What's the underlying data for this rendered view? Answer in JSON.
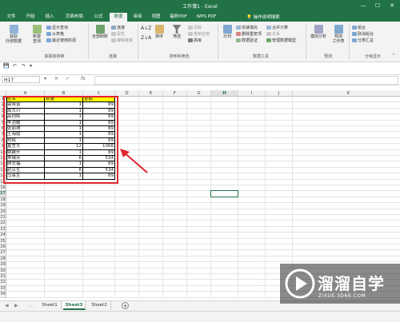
{
  "window": {
    "title": "工作簿1 - Excel",
    "controls": [
      "—",
      "☐",
      "✕"
    ]
  },
  "ribbon_tabs": [
    "文件",
    "开始",
    "插入",
    "页面布局",
    "公式",
    "数据",
    "审阅",
    "视图",
    "福昕PDF",
    "WPS PDF"
  ],
  "active_tab": "数据",
  "tell_me": "操作说明搜索",
  "ribbon": {
    "get_external_label": "获取\n外部数据",
    "new_query_label": "新建\n查询",
    "show_queries": "显示查询",
    "from_table": "从表格",
    "recent_sources": "最近使用的源",
    "group_get_transform": "获取和转换",
    "refresh_all_label": "全部刷新",
    "connections": "连接",
    "properties": "属性",
    "edit_links": "编辑链接",
    "group_connections": "连接",
    "sort_label": "排序",
    "filter_label": "筛选",
    "clear": "清除",
    "reapply": "重新应用",
    "advanced": "高级",
    "group_sort_filter": "排序和筛选",
    "text_to_columns_label": "分列",
    "flash_fill": "快速填充",
    "remove_duplicates": "删除重复项",
    "data_validation": "数据验证",
    "consolidate": "合并计算",
    "relationships": "关系",
    "manage_data_model": "管理数据模型",
    "group_data_tools": "数据工具",
    "what_if_label": "模拟分析",
    "forecast_sheet_label": "预测\n工作表",
    "group_forecast": "预测",
    "group_btn": "组合",
    "ungroup_btn": "取消组合",
    "subtotal": "分类汇总",
    "group_outline": "分级显示"
  },
  "name_box": "H17",
  "formula": "",
  "columns": [
    "A",
    "B",
    "C",
    "D",
    "E",
    "F",
    "G",
    "H",
    "I",
    "J",
    "K"
  ],
  "selected_column": "H",
  "selected_row": "17",
  "rows": [
    "1",
    "2",
    "3",
    "4",
    "5",
    "6",
    "7",
    "8",
    "9",
    "10",
    "11",
    "12",
    "13",
    "14",
    "15",
    "16",
    "17",
    "18",
    "19",
    "20",
    "21",
    "22",
    "23",
    "24",
    "25",
    "26",
    "27",
    "28",
    "29",
    "30",
    "31",
    "32",
    "33",
    "34"
  ],
  "table": {
    "headers": [
      "姓名",
      "数量",
      "金额"
    ],
    "rows": [
      [
        "龚晓普",
        "1",
        "89"
      ],
      [
        "周大川",
        "1",
        "89"
      ],
      [
        "高创辉",
        "1",
        "89"
      ],
      [
        "李洁耀",
        "1",
        "89"
      ],
      [
        "张丽琪",
        "1",
        "89"
      ],
      [
        "王海霞",
        "1",
        "89"
      ],
      [
        "刘辉",
        "1",
        "89"
      ],
      [
        "夏言文",
        "12",
        "1068"
      ],
      [
        "姚建开",
        "1",
        "89"
      ],
      [
        "朱俄芳",
        "6",
        "534"
      ],
      [
        "顾志福",
        "1",
        "89"
      ],
      [
        "赵京生",
        "6",
        "534"
      ],
      [
        "马旻生",
        "1",
        "89"
      ]
    ]
  },
  "sheet_tabs": [
    "Sheet1",
    "Sheet3",
    "Sheet2"
  ],
  "active_sheet": "Sheet3",
  "watermark": {
    "title": "溜溜自学",
    "url": "ZIXUE.3D66.COM"
  },
  "colors": {
    "excel_green": "#217346",
    "header_fill": "#ffff00",
    "highlight_red": "#e0262e"
  }
}
